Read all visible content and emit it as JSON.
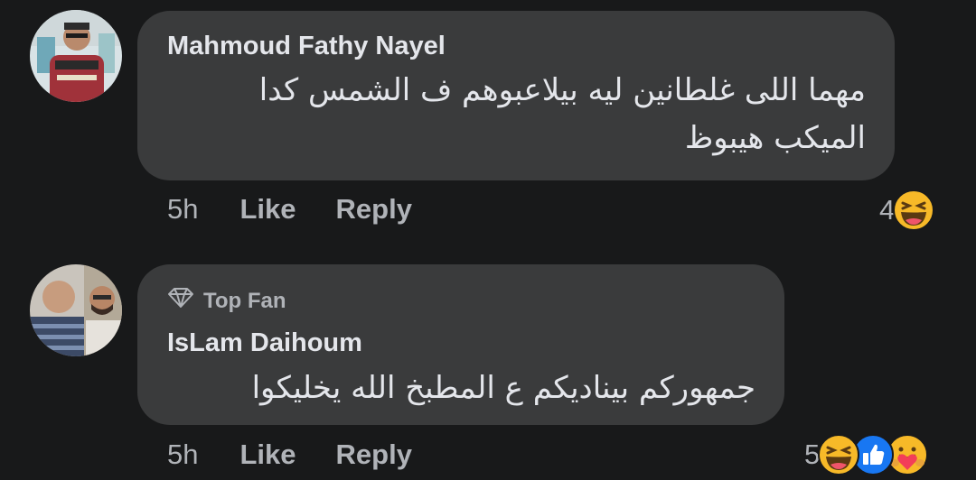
{
  "comments": [
    {
      "author": "Mahmoud Fathy Nayel",
      "text_line1": "مهما اللى غلطانين ليه بيلاعبوهم ف الشمس كدا",
      "text_line2": "الميكب هيبوظ",
      "time": "5h",
      "like_label": "Like",
      "reply_label": "Reply",
      "reaction_count": "4",
      "reactions": [
        "haha-icon"
      ]
    },
    {
      "badge": "Top Fan",
      "author": "IsLam Daihoum",
      "text_line1": "جمهوركم بيناديكم ع المطبخ الله يخليكوا",
      "time": "5h",
      "like_label": "Like",
      "reply_label": "Reply",
      "reaction_count": "5",
      "reactions": [
        "haha-icon",
        "like-icon",
        "care-icon"
      ]
    }
  ],
  "colors": {
    "background": "#18191a",
    "bubble": "#3a3b3c",
    "text_primary": "#e4e6eb",
    "text_secondary": "#b0b3b8",
    "like_blue": "#1877f2",
    "haha_yellow": "#f7b928"
  }
}
